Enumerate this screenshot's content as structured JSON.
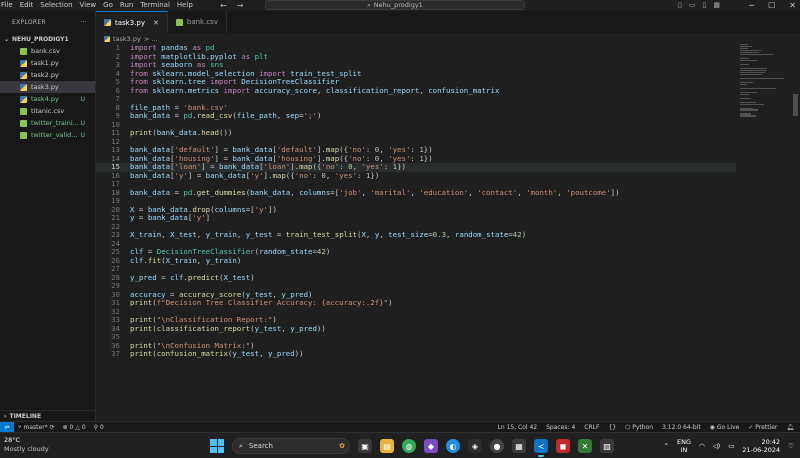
{
  "titlebar": {
    "menu": [
      "File",
      "Edit",
      "Selection",
      "View",
      "Go",
      "Run",
      "Terminal",
      "Help"
    ],
    "search_text": "Nehu_prodigy1"
  },
  "sidebar": {
    "header": "EXPLORER",
    "folder": "NEHU_PRODIGY1",
    "files": [
      {
        "name": "bank.csv",
        "type": "csv",
        "badge": "",
        "active": false
      },
      {
        "name": "task1.py",
        "type": "py",
        "badge": "",
        "active": false
      },
      {
        "name": "task2.py",
        "type": "py",
        "badge": "",
        "active": false
      },
      {
        "name": "task3.py",
        "type": "py",
        "badge": "",
        "active": true
      },
      {
        "name": "task4.py",
        "type": "py",
        "badge": "U",
        "active": false
      },
      {
        "name": "titanic.csv",
        "type": "csv",
        "badge": "",
        "active": false
      },
      {
        "name": "twitter_traini...",
        "type": "csv",
        "badge": "U",
        "active": false
      },
      {
        "name": "twitter_valid...",
        "type": "csv",
        "badge": "U",
        "active": false
      }
    ],
    "timeline": "TIMELINE"
  },
  "tabs": [
    {
      "label": "task3.py",
      "active": true
    },
    {
      "label": "bank.csv",
      "active": false
    }
  ],
  "breadcrumb": {
    "file": "task3.py",
    "rest": "> ..."
  },
  "code": [
    "import pandas as pd",
    "import matplotlib.pyplot as plt",
    "import seaborn as sns",
    "from sklearn.model_selection import train_test_split",
    "from sklearn.tree import DecisionTreeClassifier",
    "from sklearn.metrics import accuracy_score, classification_report, confusion_matrix",
    "",
    "file_path = 'bank.csv'",
    "bank_data = pd.read_csv(file_path, sep=';')",
    "",
    "print(bank_data.head())",
    "",
    "bank_data['default'] = bank_data['default'].map({'no': 0, 'yes': 1})",
    "bank_data['housing'] = bank_data['housing'].map({'no': 0, 'yes': 1})",
    "bank_data['loan'] = bank_data['loan'].map({'no': 0, 'yes': 1})",
    "bank_data['y'] = bank_data['y'].map({'no': 0, 'yes': 1})",
    "",
    "bank_data = pd.get_dummies(bank_data, columns=['job', 'marital', 'education', 'contact', 'month', 'poutcome'])",
    "",
    "X = bank_data.drop(columns=['y'])",
    "y = bank_data['y']",
    "",
    "X_train, X_test, y_train, y_test = train_test_split(X, y, test_size=0.3, random_state=42)",
    "",
    "clf = DecisionTreeClassifier(random_state=42)",
    "clf.fit(X_train, y_train)",
    "",
    "y_pred = clf.predict(X_test)",
    "",
    "accuracy = accuracy_score(y_test, y_pred)",
    "print(f\"Decision Tree Classifier Accuracy: {accuracy:.2f}\")",
    "",
    "print(\"\\nClassification Report:\")",
    "print(classification_report(y_test, y_pred))",
    "",
    "print(\"\\nConfusion Matrix:\")",
    "print(confusion_matrix(y_test, y_pred))"
  ],
  "cursor_line": 15,
  "statusbar": {
    "branch": "master*",
    "errors": "0",
    "warnings": "0",
    "ports": "0",
    "position": "Ln 15, Col 42",
    "spaces": "Spaces: 4",
    "eol": "CRLF",
    "language": "Python",
    "interpreter": "3.12.0 64-bit",
    "golive": "Go Live",
    "prettier": "Prettier"
  },
  "taskbar": {
    "temp": "28°C",
    "weather": "Mostly cloudy",
    "search": "Search",
    "lang_top": "ENG",
    "lang_bottom": "IN",
    "time": "20:42",
    "date": "21-06-2024"
  }
}
